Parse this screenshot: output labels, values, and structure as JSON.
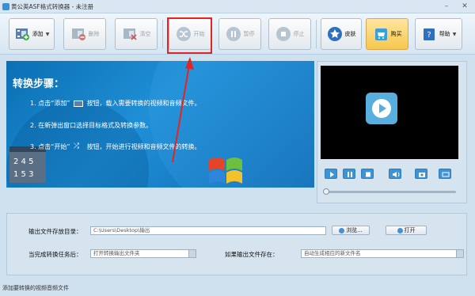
{
  "window": {
    "title": "黄公英ASF格式转换器 - 未注册"
  },
  "toolbar": {
    "add_label": "添加",
    "delete_label": "删除",
    "clear_label": "清空",
    "start_label": "开始",
    "pause_label": "暂停",
    "stop_label": "停止",
    "skin_label": "皮肤",
    "buy_label": "购买",
    "help_label": "帮助"
  },
  "guide": {
    "title": "转换步骤：",
    "step1_a": "1. 点击“添加”",
    "step1_b": "按钮，载入需要转换的视频和音频文件。",
    "step2": "2. 在新弹出窗口选择目标格式及转换参数。",
    "step3_a": "3. 点击“开始”",
    "step3_b": "按钮，开始进行视频和音频文件的转换。"
  },
  "output": {
    "dir_label": "输出文件存放目录：",
    "dir_value": "C:\\Users\\Desktop\\输出",
    "browse_label": "浏览...",
    "open_label": "打开",
    "after_label": "当完成转换任务后：",
    "after_value": "打开转换输出文件夹",
    "exists_label": "如果输出文件存在：",
    "exists_value": "自动生成相应的新文件名"
  },
  "status": {
    "text": "添加要转换的视频音频文件"
  },
  "player": {
    "progress": 0
  }
}
